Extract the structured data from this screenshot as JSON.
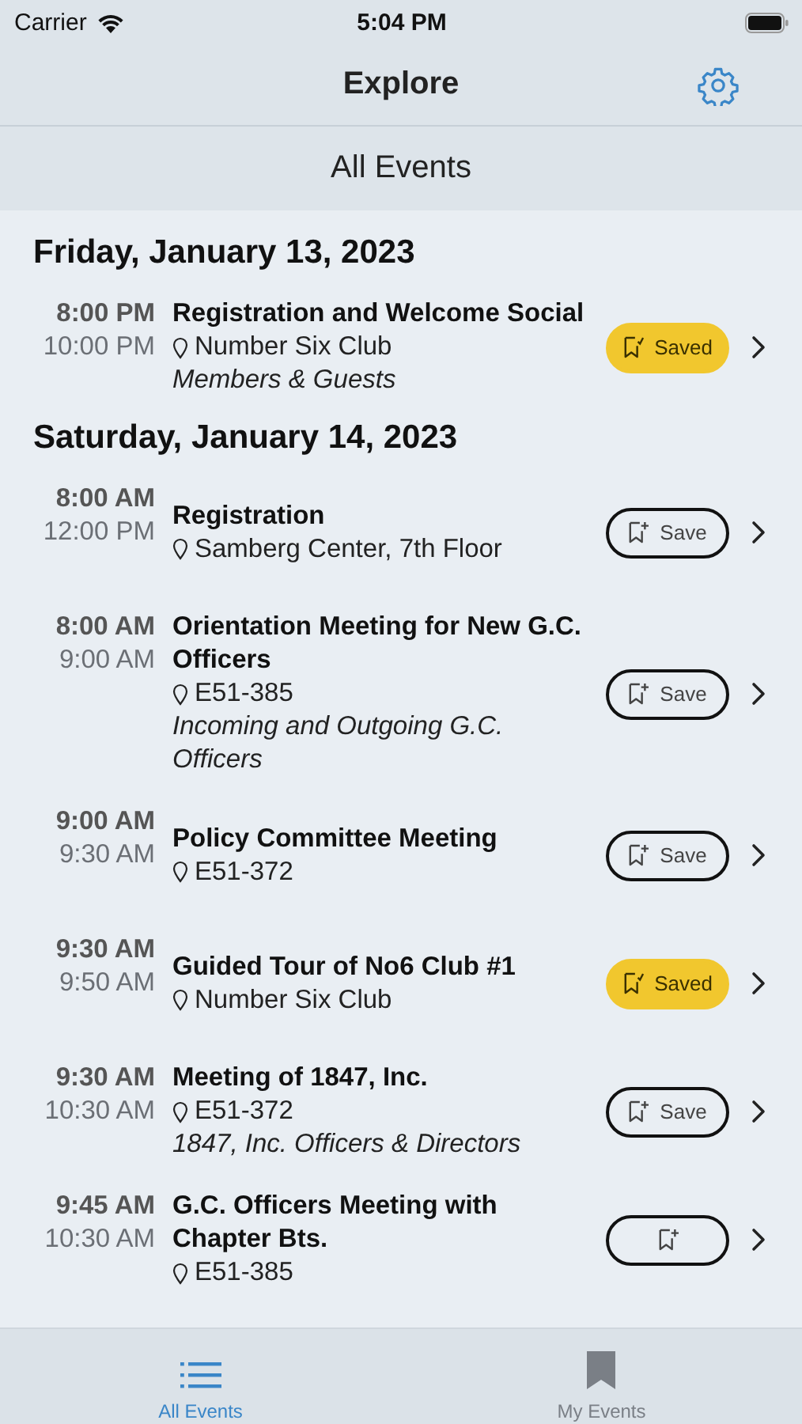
{
  "status_bar": {
    "carrier": "Carrier",
    "time": "5:04 PM"
  },
  "nav": {
    "title": "Explore"
  },
  "section_title": "All Events",
  "days": [
    {
      "date": "Friday, January 13, 2023",
      "events": [
        {
          "start": "8:00 PM",
          "end": "10:00 PM",
          "title": "Registration and Welcome Social",
          "location": "Number Six Club",
          "note": "Members & Guests",
          "saved": true,
          "save_label": "Saved"
        }
      ]
    },
    {
      "date": "Saturday, January 14, 2023",
      "events": [
        {
          "start": "8:00 AM",
          "end": "12:00 PM",
          "title": "Registration",
          "location": "Samberg Center, 7th Floor",
          "saved": false,
          "save_label": "Save"
        },
        {
          "start": "8:00 AM",
          "end": "9:00 AM",
          "title": "Orientation Meeting for New G.C. Officers",
          "location": "E51-385",
          "note": "Incoming and Outgoing G.C. Officers",
          "saved": false,
          "save_label": "Save"
        },
        {
          "start": "9:00 AM",
          "end": "9:30 AM",
          "title": "Policy Committee Meeting",
          "location": "E51-372",
          "saved": false,
          "save_label": "Save"
        },
        {
          "start": "9:30 AM",
          "end": "9:50 AM",
          "title": "Guided Tour of No6 Club #1",
          "location": "Number Six Club",
          "saved": true,
          "save_label": "Saved"
        },
        {
          "start": "9:30 AM",
          "end": "10:30 AM",
          "title": "Meeting of 1847, Inc.",
          "location": "E51-372",
          "note": "1847, Inc. Officers & Directors",
          "saved": false,
          "save_label": "Save"
        },
        {
          "start": "9:45 AM",
          "end": "10:30 AM",
          "title": "G.C. Officers Meeting with Chapter Bts.",
          "location": "E51-385",
          "saved": false
        }
      ]
    }
  ],
  "tabs": [
    {
      "label": "All Events",
      "kind": "list",
      "selected": true
    },
    {
      "label": "My Events",
      "kind": "bookmark",
      "selected": false
    }
  ]
}
